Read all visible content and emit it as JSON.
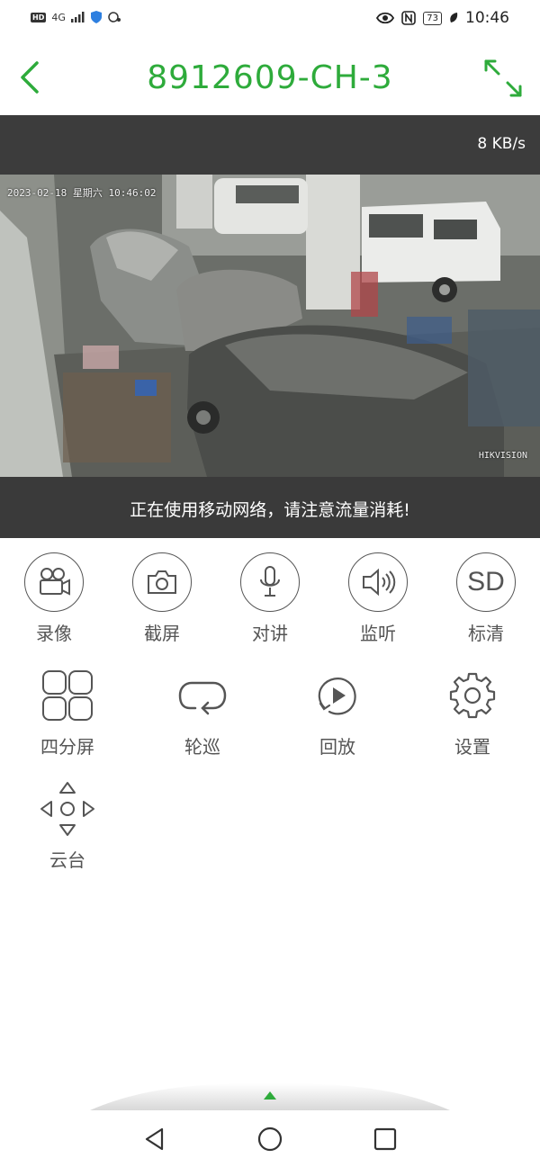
{
  "status_bar": {
    "hd": "HD",
    "network": "4G",
    "battery": "73",
    "time": "10:46"
  },
  "header": {
    "title": "8912609-CH-3"
  },
  "video": {
    "rate": "8 KB/s",
    "osd_time": "2023-02-18 星期六 10:46:02",
    "osd_brand": "HIKVISION",
    "notice": "正在使用移动网络，请注意流量消耗!"
  },
  "controls": {
    "record": "录像",
    "screenshot": "截屏",
    "talk": "对讲",
    "listen": "监听",
    "quality": "标清",
    "quality_badge": "SD",
    "quad_view": "四分屏",
    "patrol": "轮巡",
    "playback": "回放",
    "settings": "设置",
    "ptz": "云台"
  },
  "colors": {
    "accent": "#2eab3b",
    "icon": "#555555",
    "dark_bar": "#3c3c3c"
  }
}
